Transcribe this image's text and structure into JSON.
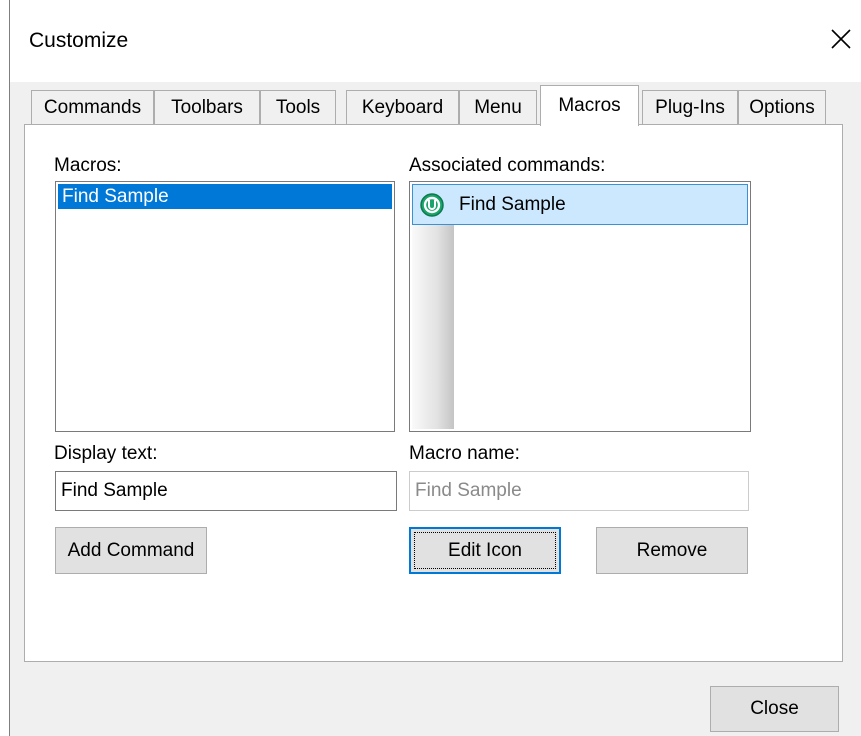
{
  "window": {
    "title": "Customize"
  },
  "tabs": [
    {
      "label": "Commands",
      "active": false
    },
    {
      "label": "Toolbars",
      "active": false
    },
    {
      "label": "Tools",
      "active": false
    },
    {
      "label": "Keyboard",
      "active": false
    },
    {
      "label": "Menu",
      "active": false
    },
    {
      "label": "Macros",
      "active": true
    },
    {
      "label": "Plug-Ins",
      "active": false
    },
    {
      "label": "Options",
      "active": false
    }
  ],
  "macros": {
    "label": "Macros:",
    "items": [
      "Find Sample"
    ],
    "selected": "Find Sample"
  },
  "associated": {
    "label": "Associated commands:",
    "items": [
      {
        "label": "Find Sample",
        "icon": "macro-u-icon"
      }
    ]
  },
  "display_text": {
    "label": "Display text:",
    "value": "Find Sample"
  },
  "macro_name": {
    "label": "Macro name:",
    "value": "Find Sample"
  },
  "buttons": {
    "add_command": "Add Command",
    "edit_icon": "Edit Icon",
    "remove": "Remove",
    "close": "Close"
  },
  "colors": {
    "selection": "#0078d7",
    "assoc_selection": "#cce8ff",
    "icon_green": "#1aa36b"
  }
}
